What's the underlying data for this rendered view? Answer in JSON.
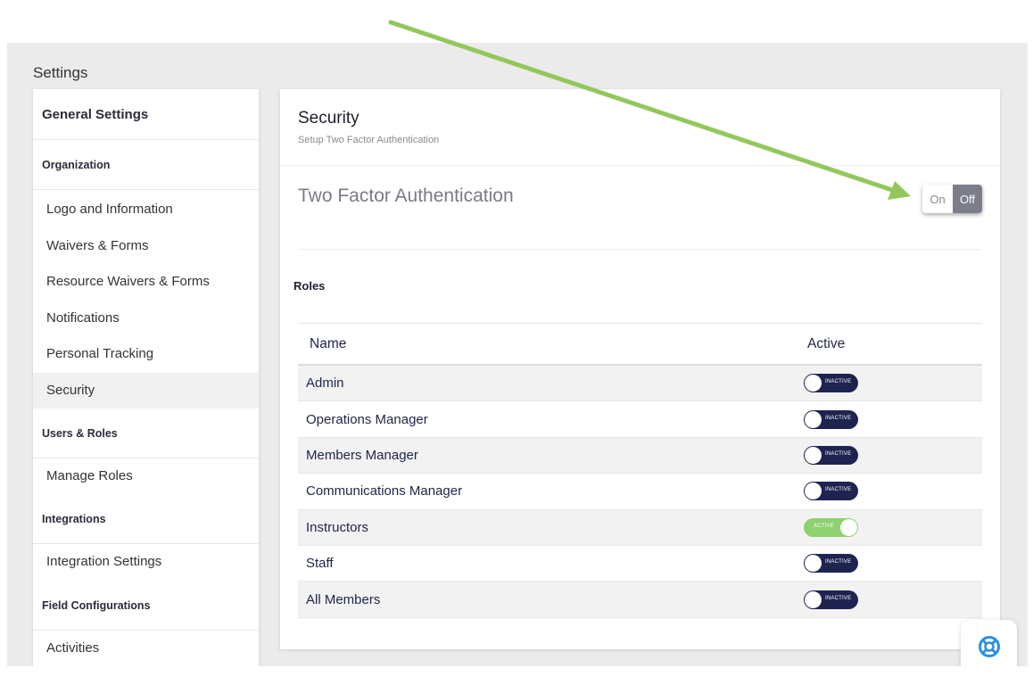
{
  "page": {
    "title": "Settings"
  },
  "sidebar": {
    "header": "General Settings",
    "sections": [
      {
        "title": "Organization",
        "items": [
          "Logo and Information",
          "Waivers & Forms",
          "Resource Waivers & Forms",
          "Notifications",
          "Personal Tracking",
          "Security"
        ]
      },
      {
        "title": "Users & Roles",
        "items": [
          "Manage Roles"
        ]
      },
      {
        "title": "Integrations",
        "items": [
          "Integration Settings"
        ]
      },
      {
        "title": "Field Configurations",
        "items": [
          "Activities"
        ]
      }
    ],
    "active_item": "Security"
  },
  "main": {
    "title": "Security",
    "subtitle": "Setup Two Factor Authentication",
    "tfa": {
      "label": "Two Factor Authentication",
      "on_label": "On",
      "off_label": "Off",
      "state": "Off"
    },
    "roles": {
      "label": "Roles",
      "columns": [
        "Name",
        "Active"
      ],
      "rows": [
        {
          "name": "Admin",
          "status": "INACTIVE"
        },
        {
          "name": "Operations Manager",
          "status": "INACTIVE"
        },
        {
          "name": "Members Manager",
          "status": "INACTIVE"
        },
        {
          "name": "Communications Manager",
          "status": "INACTIVE"
        },
        {
          "name": "Instructors",
          "status": "ACTIVE"
        },
        {
          "name": "Staff",
          "status": "INACTIVE"
        },
        {
          "name": "All Members",
          "status": "INACTIVE"
        }
      ]
    }
  },
  "colors": {
    "accent_active": "#8fd071",
    "toggle_inactive": "#1f2350",
    "annotation_arrow": "#92c75c",
    "help_icon": "#2b8fe0"
  },
  "icons": {
    "help": "lifebuoy-icon"
  }
}
